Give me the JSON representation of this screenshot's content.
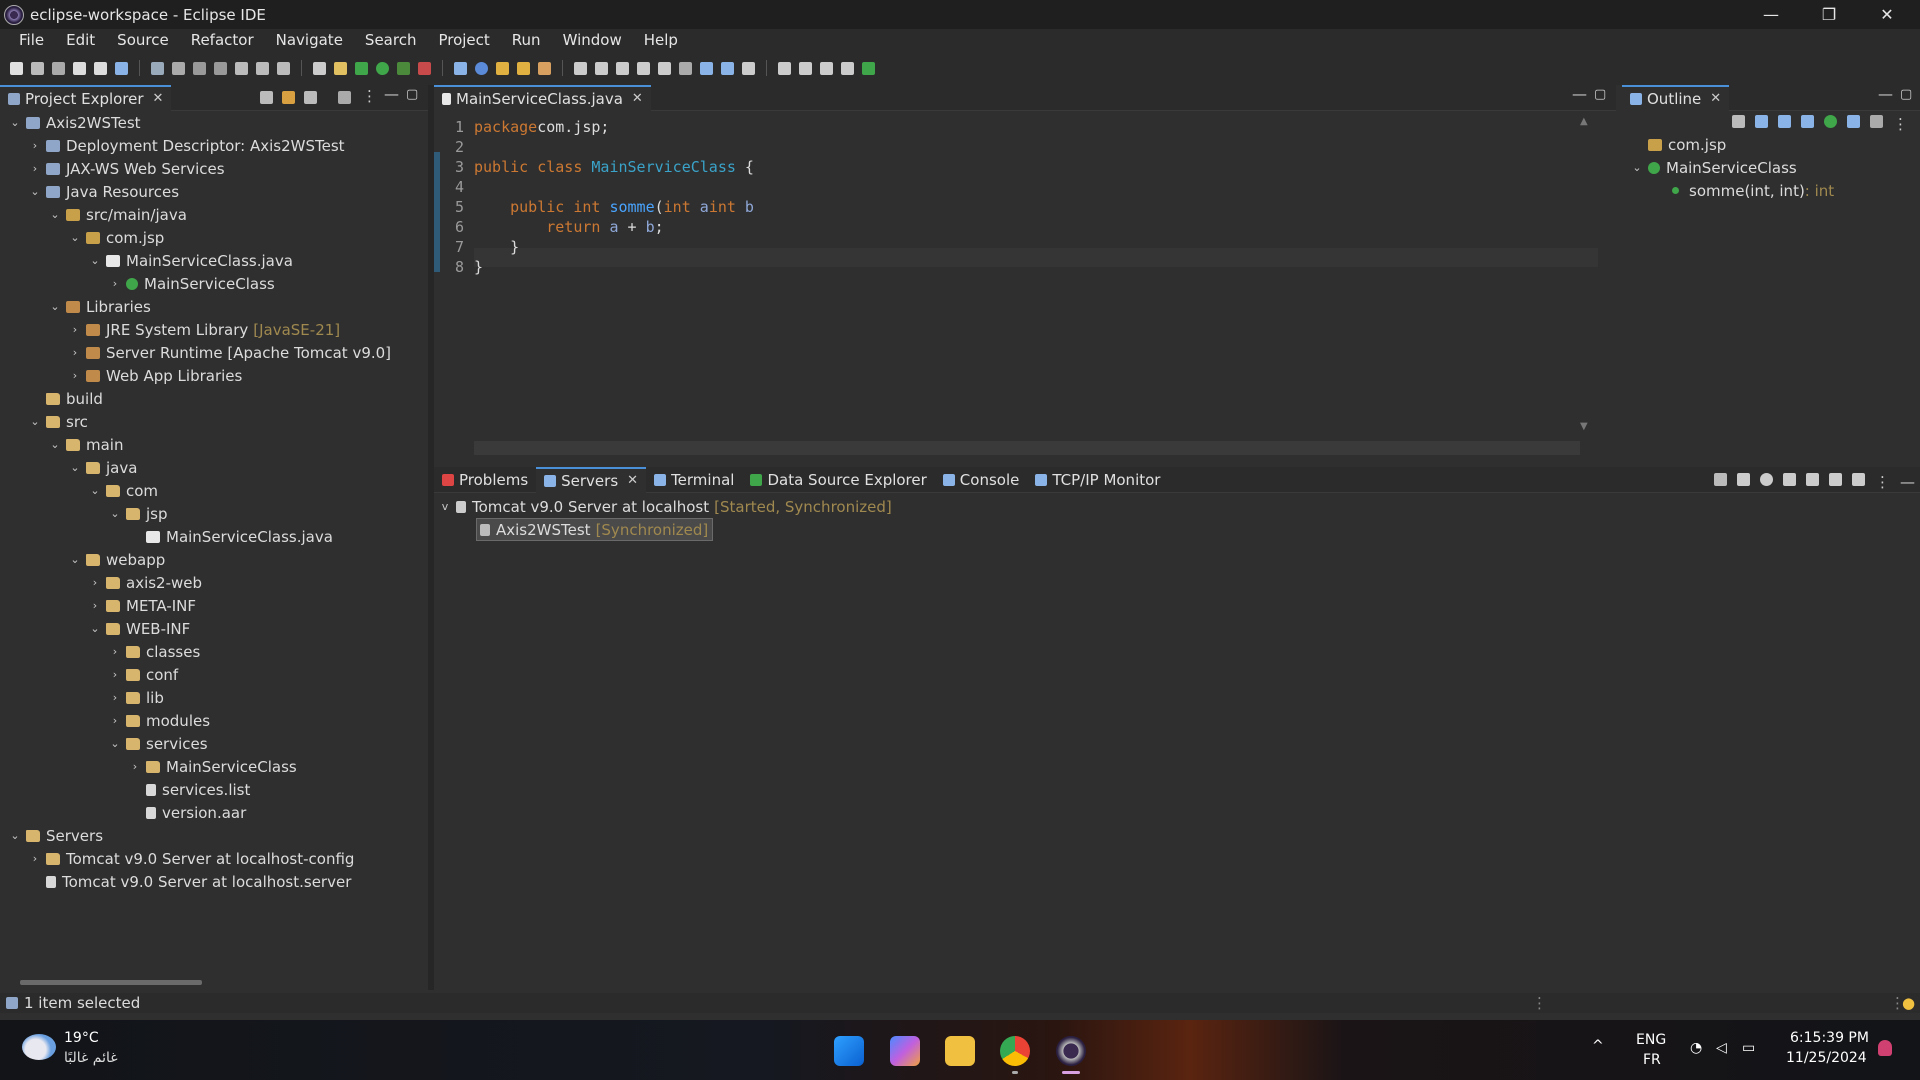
{
  "window": {
    "title": "eclipse-workspace - Eclipse IDE",
    "minimize": "—",
    "restore": "❐",
    "close": "✕"
  },
  "menu": [
    "File",
    "Edit",
    "Source",
    "Refactor",
    "Navigate",
    "Search",
    "Project",
    "Run",
    "Window",
    "Help"
  ],
  "project_explorer": {
    "tab_label": "Project Explorer",
    "items": [
      {
        "label": "Axis2WSTest",
        "depth": 0,
        "chev": "v",
        "icon": "proj"
      },
      {
        "label": "Deployment Descriptor: Axis2WSTest",
        "depth": 1,
        "chev": ">",
        "icon": "proj"
      },
      {
        "label": "JAX-WS Web Services",
        "depth": 1,
        "chev": ">",
        "icon": "proj"
      },
      {
        "label": "Java Resources",
        "depth": 1,
        "chev": "v",
        "icon": "proj"
      },
      {
        "label": "src/main/java",
        "depth": 2,
        "chev": "v",
        "icon": "pkg"
      },
      {
        "label": "com.jsp",
        "depth": 3,
        "chev": "v",
        "icon": "pkg"
      },
      {
        "label": "MainServiceClass.java",
        "depth": 4,
        "chev": "v",
        "icon": "jfile"
      },
      {
        "label": "MainServiceClass",
        "depth": 5,
        "chev": ">",
        "icon": "cls"
      },
      {
        "label": "Libraries",
        "depth": 2,
        "chev": "v",
        "icon": "lib"
      },
      {
        "label": "JRE System Library",
        "depth": 3,
        "chev": ">",
        "icon": "lib",
        "deco": "[JavaSE-21]"
      },
      {
        "label": "Server Runtime [Apache Tomcat v9.0]",
        "depth": 3,
        "chev": ">",
        "icon": "lib"
      },
      {
        "label": "Web App Libraries",
        "depth": 3,
        "chev": ">",
        "icon": "lib"
      },
      {
        "label": "build",
        "depth": 1,
        "chev": "",
        "icon": "folder"
      },
      {
        "label": "src",
        "depth": 1,
        "chev": "v",
        "icon": "folder"
      },
      {
        "label": "main",
        "depth": 2,
        "chev": "v",
        "icon": "folder"
      },
      {
        "label": "java",
        "depth": 3,
        "chev": "v",
        "icon": "folder"
      },
      {
        "label": "com",
        "depth": 4,
        "chev": "v",
        "icon": "folder"
      },
      {
        "label": "jsp",
        "depth": 5,
        "chev": "v",
        "icon": "folder"
      },
      {
        "label": "MainServiceClass.java",
        "depth": 6,
        "chev": "",
        "icon": "jfile"
      },
      {
        "label": "webapp",
        "depth": 3,
        "chev": "v",
        "icon": "folder"
      },
      {
        "label": "axis2-web",
        "depth": 4,
        "chev": ">",
        "icon": "folder"
      },
      {
        "label": "META-INF",
        "depth": 4,
        "chev": ">",
        "icon": "folder"
      },
      {
        "label": "WEB-INF",
        "depth": 4,
        "chev": "v",
        "icon": "folder"
      },
      {
        "label": "classes",
        "depth": 5,
        "chev": ">",
        "icon": "folder"
      },
      {
        "label": "conf",
        "depth": 5,
        "chev": ">",
        "icon": "folder"
      },
      {
        "label": "lib",
        "depth": 5,
        "chev": ">",
        "icon": "folder"
      },
      {
        "label": "modules",
        "depth": 5,
        "chev": ">",
        "icon": "folder"
      },
      {
        "label": "services",
        "depth": 5,
        "chev": "v",
        "icon": "folder"
      },
      {
        "label": "MainServiceClass",
        "depth": 6,
        "chev": ">",
        "icon": "folder"
      },
      {
        "label": "services.list",
        "depth": 6,
        "chev": "",
        "icon": "file"
      },
      {
        "label": "version.aar",
        "depth": 6,
        "chev": "",
        "icon": "file"
      },
      {
        "label": "Servers",
        "depth": 0,
        "chev": "v",
        "icon": "folder"
      },
      {
        "label": "Tomcat v9.0 Server at localhost-config",
        "depth": 1,
        "chev": ">",
        "icon": "folder"
      },
      {
        "label": "Tomcat v9.0 Server at localhost.server",
        "depth": 1,
        "chev": "",
        "icon": "file"
      }
    ]
  },
  "editor": {
    "tab_label": "MainServiceClass.java",
    "lines": [
      {
        "n": "1",
        "parts": [
          [
            "kw",
            "package"
          ],
          [
            "",
            "com.jsp;"
          ]
        ]
      },
      {
        "n": "2",
        "parts": []
      },
      {
        "n": "3",
        "parts": [
          [
            "kw",
            "public class"
          ],
          [
            "ty",
            " MainServiceClass"
          ],
          [
            "",
            " {"
          ]
        ]
      },
      {
        "n": "4",
        "parts": []
      },
      {
        "n": "5",
        "parts": [
          [
            "",
            "    "
          ],
          [
            "kw",
            "public int"
          ],
          [
            "fn",
            " somme"
          ],
          [
            "",
            "("
          ],
          [
            "kw",
            "int"
          ],
          [
            "pm",
            " a"
          ],
          [
            ",  "
          ],
          [
            "kw",
            "int"
          ],
          [
            "pm",
            " b"
          ],
          [
            ") {"
          ]
        ]
      },
      {
        "n": "6",
        "parts": [
          [
            "",
            "        "
          ],
          [
            "kw",
            "return"
          ],
          [
            "pm",
            " a"
          ],
          [
            "",
            " + "
          ],
          [
            "pm",
            "b"
          ],
          [
            "",
            ";"
          ]
        ]
      },
      {
        "n": "7",
        "parts": [
          [
            "",
            "    }"
          ]
        ]
      },
      {
        "n": "8",
        "parts": [
          [
            "",
            "}"
          ]
        ]
      }
    ]
  },
  "outline": {
    "tab_label": "Outline",
    "items": [
      {
        "label": "com.jsp",
        "depth": 0,
        "chev": "",
        "icon": "pkg"
      },
      {
        "label": "MainServiceClass",
        "depth": 0,
        "chev": "v",
        "icon": "cls"
      },
      {
        "label": "somme(int, int)",
        "depth": 1,
        "chev": "",
        "icon": "dot",
        "type": " : int"
      }
    ]
  },
  "bottom": {
    "tabs": [
      "Problems",
      "Servers",
      "Terminal",
      "Data Source Explorer",
      "Console",
      "TCP/IP Monitor"
    ],
    "active": "Servers",
    "server": {
      "label": "Tomcat v9.0 Server at localhost",
      "state": "[Started, Synchronized]"
    },
    "module": {
      "label": "Axis2WSTest",
      "state": "[Synchronized]"
    }
  },
  "status": {
    "text": "1 item selected"
  },
  "taskbar": {
    "weather_temp": "19°C",
    "weather_desc": "غائم غالبًا",
    "lang1": "ENG",
    "lang2": "FR",
    "time": "6:15:39 PM",
    "date": "11/25/2024"
  }
}
